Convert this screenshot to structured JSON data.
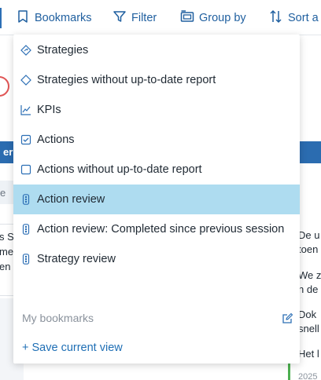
{
  "toolbar": {
    "bookmarks_label": "Bookmarks",
    "filter_label": "Filter",
    "group_label": "Group by",
    "sort_label": "Sort a"
  },
  "background": {
    "band_text": "er",
    "grey_row_text": "e",
    "left_card_lines": [
      "s S",
      "me",
      "en"
    ],
    "right_lines": [
      "De u",
      "toen",
      "We z",
      "n de",
      "Dok",
      "snell",
      "Het l",
      "2025"
    ]
  },
  "menu": {
    "items": [
      {
        "label": "Strategies",
        "icon": "strategy-diamond-icon",
        "active": false
      },
      {
        "label": "Strategies without up-to-date report",
        "icon": "diamond-outline-icon",
        "active": false
      },
      {
        "label": "KPIs",
        "icon": "kpi-chart-icon",
        "active": false
      },
      {
        "label": "Actions",
        "icon": "checkbox-checked-icon",
        "active": false
      },
      {
        "label": "Actions without up-to-date report",
        "icon": "checkbox-empty-icon",
        "active": false
      },
      {
        "label": "Action review",
        "icon": "traffic-light-icon",
        "active": true
      },
      {
        "label": "Action review: Completed since previous session",
        "icon": "traffic-light-icon",
        "active": false
      },
      {
        "label": "Strategy review",
        "icon": "traffic-light-icon",
        "active": false
      }
    ],
    "footer_title": "My bookmarks",
    "save_label": "+ Save current view"
  },
  "colors": {
    "accent": "#1f5f9f",
    "active_row": "#aedcf0",
    "band": "#2b6cb0"
  }
}
